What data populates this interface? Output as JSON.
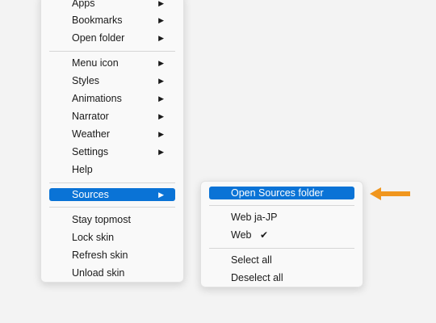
{
  "main_menu": {
    "items": [
      {
        "label": "Apps",
        "submenu": true
      },
      {
        "label": "Bookmarks",
        "submenu": true
      },
      {
        "label": "Open folder",
        "submenu": true
      },
      {
        "label": "Menu icon",
        "submenu": true
      },
      {
        "label": "Styles",
        "submenu": true
      },
      {
        "label": "Animations",
        "submenu": true
      },
      {
        "label": "Narrator",
        "submenu": true
      },
      {
        "label": "Weather",
        "submenu": true
      },
      {
        "label": "Settings",
        "submenu": true
      },
      {
        "label": "Help",
        "submenu": false
      },
      {
        "label": "Sources",
        "submenu": true,
        "highlighted": true
      },
      {
        "label": "Stay topmost",
        "submenu": false
      },
      {
        "label": "Lock skin",
        "submenu": false
      },
      {
        "label": "Refresh skin",
        "submenu": false
      },
      {
        "label": "Unload skin",
        "submenu": false
      }
    ],
    "chevron_glyph": "▶"
  },
  "sub_menu": {
    "items": [
      {
        "label": "Open Sources folder",
        "highlighted": true
      },
      {
        "label": "Web ja-JP",
        "checked": false
      },
      {
        "label": "Web",
        "checked": true
      },
      {
        "label": "Select all"
      },
      {
        "label": "Deselect all"
      }
    ],
    "check_glyph": "✔"
  },
  "colors": {
    "highlight": "#0a73d6",
    "arrow": "#f0961e",
    "menu_bg": "#f9f9f9",
    "page_bg": "#f3f3f3"
  },
  "icons": {
    "submenu_indicator": "chevron-right-icon",
    "pointer": "arrow-left-icon",
    "checkmark": "checkmark-icon"
  }
}
